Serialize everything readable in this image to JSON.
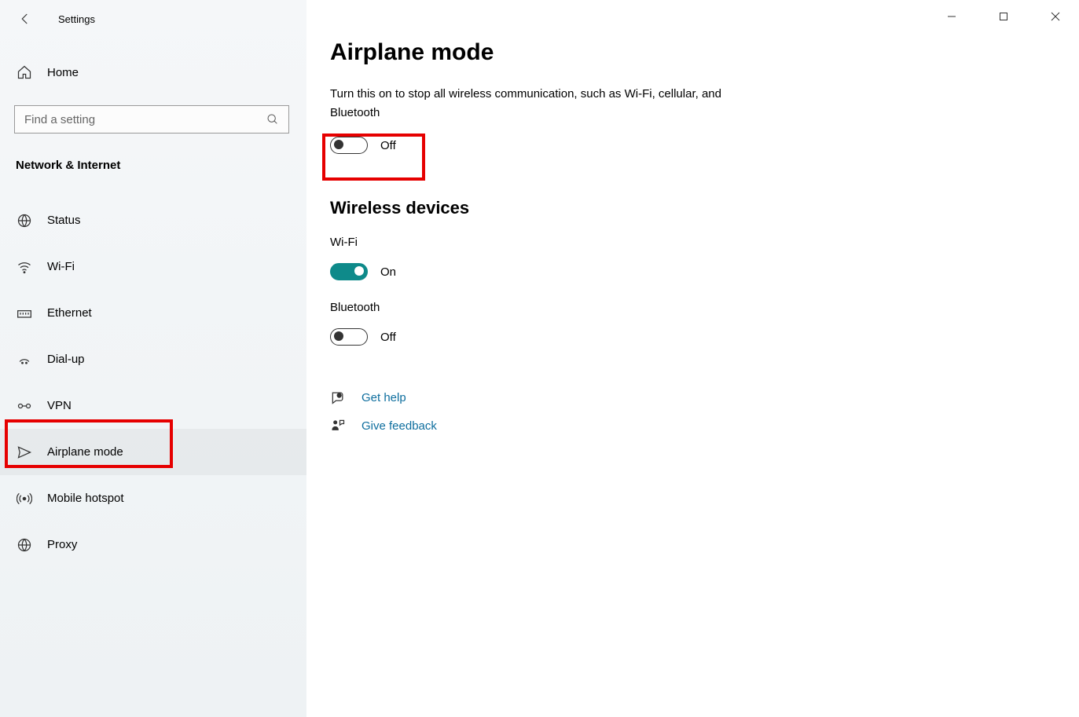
{
  "window": {
    "title": "Settings"
  },
  "sidebar": {
    "home": "Home",
    "search_placeholder": "Find a setting",
    "section": "Network & Internet",
    "items": [
      {
        "label": "Status"
      },
      {
        "label": "Wi-Fi"
      },
      {
        "label": "Ethernet"
      },
      {
        "label": "Dial-up"
      },
      {
        "label": "VPN"
      },
      {
        "label": "Airplane mode"
      },
      {
        "label": "Mobile hotspot"
      },
      {
        "label": "Proxy"
      }
    ]
  },
  "main": {
    "title": "Airplane mode",
    "description": "Turn this on to stop all wireless communication, such as Wi-Fi, cellular, and Bluetooth",
    "airplane_toggle": {
      "state": "Off"
    },
    "wireless_heading": "Wireless devices",
    "wifi": {
      "label": "Wi-Fi",
      "state": "On"
    },
    "bluetooth": {
      "label": "Bluetooth",
      "state": "Off"
    },
    "help_link": "Get help",
    "feedback_link": "Give feedback"
  }
}
